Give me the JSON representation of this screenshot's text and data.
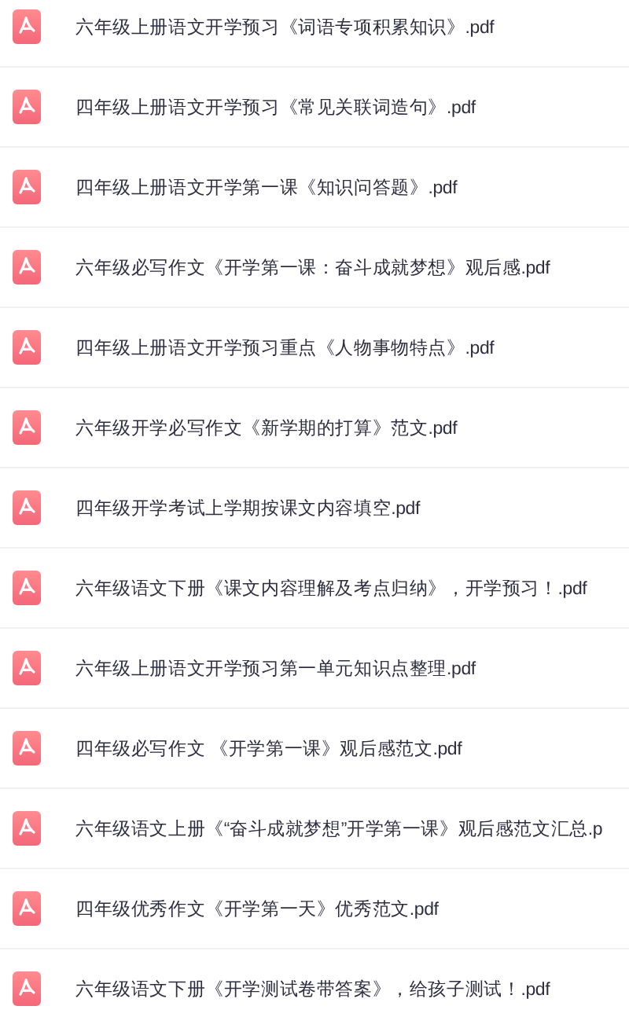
{
  "files": [
    {
      "name": "六年级上册语文开学预习《词语专项积累知识》.pdf"
    },
    {
      "name": "四年级上册语文开学预习《常见关联词造句》.pdf"
    },
    {
      "name": "四年级上册语文开学第一课《知识问答题》.pdf"
    },
    {
      "name": "六年级必写作文《开学第一课：奋斗成就梦想》观后感.pdf"
    },
    {
      "name": "四年级上册语文开学预习重点《人物事物特点》.pdf"
    },
    {
      "name": "六年级开学必写作文《新学期的打算》范文.pdf"
    },
    {
      "name": "四年级开学考试上学期按课文内容填空.pdf"
    },
    {
      "name": "六年级语文下册《课文内容理解及考点归纳》，开学预习！.pdf"
    },
    {
      "name": "六年级上册语文开学预习第一单元知识点整理.pdf"
    },
    {
      "name": "四年级必写作文 《开学第一课》观后感范文.pdf"
    },
    {
      "name": "六年级语文上册《“奋斗成就梦想”开学第一课》观后感范文汇总.p"
    },
    {
      "name": "四年级优秀作文《开学第一天》优秀范文.pdf"
    },
    {
      "name": "六年级语文下册《开学测试卷带答案》，给孩子测试！.pdf"
    }
  ]
}
